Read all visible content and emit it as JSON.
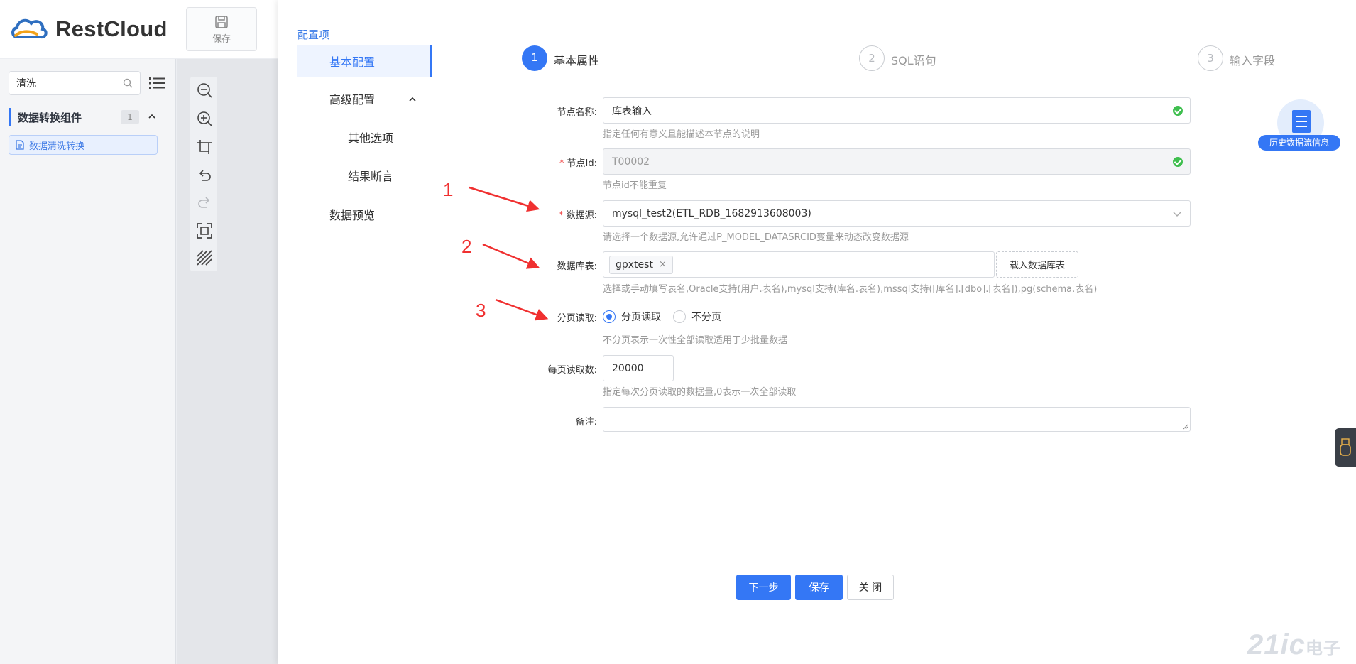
{
  "app": {
    "brand": "RestCloud",
    "toolbar": {
      "save_label": "保存"
    }
  },
  "left_panel": {
    "search_value": "清洗",
    "group": {
      "title": "数据转换组件",
      "count": "1"
    },
    "items": [
      {
        "label": "数据清洗转换"
      }
    ]
  },
  "drawer": {
    "config_title": "配置项",
    "nav": [
      {
        "label": "基本配置",
        "active": true
      },
      {
        "label": "高级配置"
      },
      {
        "label": "其他选项"
      },
      {
        "label": "结果断言"
      },
      {
        "label": "数据预览"
      }
    ],
    "steps": [
      {
        "num": "1",
        "label": "基本属性"
      },
      {
        "num": "2",
        "label": "SQL语句"
      },
      {
        "num": "3",
        "label": "输入字段"
      }
    ],
    "form": {
      "node_name": {
        "label": "节点名称:",
        "value": "库表输入",
        "help": "指定任何有意义且能描述本节点的说明"
      },
      "node_id": {
        "label": "节点Id:",
        "value": "T00002",
        "help": "节点id不能重复"
      },
      "datasource": {
        "label": "数据源:",
        "value": "mysql_test2(ETL_RDB_1682913608003)",
        "help": "请选择一个数据源,允许通过P_MODEL_DATASRCID变量来动态改变数据源"
      },
      "db_table": {
        "label": "数据库表:",
        "tag": "gpxtest",
        "tag_close": "×",
        "load_button": "载入数据库表",
        "help": "选择或手动填写表名,Oracle支持(用户.表名),mysql支持(库名.表名),mssql支持([库名].[dbo].[表名]),pg(schema.表名)"
      },
      "paging": {
        "label": "分页读取:",
        "option_on": "分页读取",
        "option_off": "不分页",
        "selected": "分页读取",
        "help": "不分页表示一次性全部读取适用于少批量数据"
      },
      "page_size": {
        "label": "每页读取数:",
        "value": "20000",
        "help": "指定每次分页读取的数据量,0表示一次全部读取"
      },
      "remark": {
        "label": "备注:",
        "value": ""
      }
    },
    "buttons": {
      "next": "下一步",
      "save": "保存",
      "close": "关 闭"
    },
    "history_badge": "历史数据流信息"
  },
  "annotations": [
    "1",
    "2",
    "3"
  ],
  "watermark": {
    "main": "21ic",
    "sub": "电子网"
  },
  "colors": {
    "accent": "#3477f5",
    "success": "#3fbf4f",
    "annotation": "#f03030"
  }
}
